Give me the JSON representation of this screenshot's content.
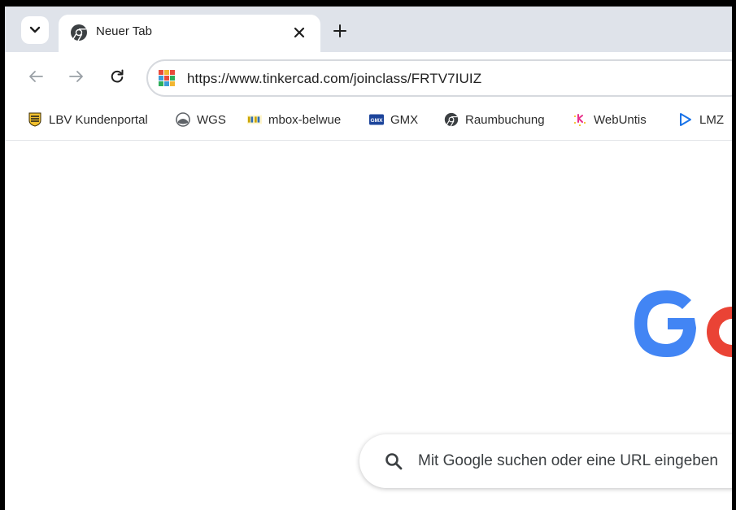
{
  "tab": {
    "title": "Neuer Tab",
    "close_icon": "close-icon",
    "new_tab_icon": "plus-icon",
    "search_tabs_icon": "chevron-down-icon"
  },
  "toolbar": {
    "url": "https://www.tinkercad.com/joinclass/FRTV7IUIZ",
    "back_icon": "arrow-left-icon",
    "forward_icon": "arrow-right-icon",
    "reload_icon": "reload-icon"
  },
  "bookmarks": [
    {
      "label": "LBV Kundenportal",
      "icon": "coat-of-arms-icon"
    },
    {
      "label": "WGS",
      "icon": "globe-icon"
    },
    {
      "label": "mbox-belwue",
      "icon": "belwue-icon"
    },
    {
      "label": "GMX",
      "icon": "gmx-icon"
    },
    {
      "label": "Raumbuchung",
      "icon": "chrome-icon"
    },
    {
      "label": "WebUntis",
      "icon": "webuntis-icon"
    },
    {
      "label": "LMZ",
      "icon": "play-icon"
    }
  ],
  "newtab": {
    "search_placeholder": "Mit Google suchen oder eine URL eingeben"
  },
  "colors": {
    "tabstrip": "#dfe3ea",
    "google_blue": "#4285f4",
    "google_red": "#ea4335"
  }
}
